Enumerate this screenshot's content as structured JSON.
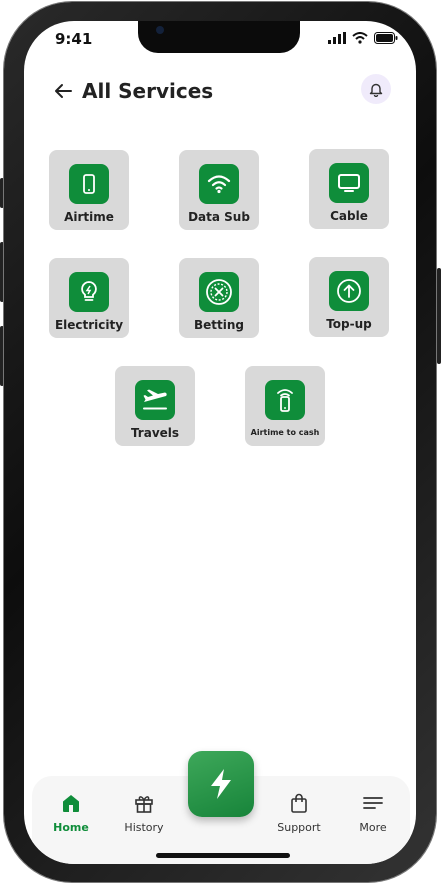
{
  "status_bar": {
    "time": "9:41"
  },
  "header": {
    "title": "All Services"
  },
  "services": [
    {
      "label": "Airtime",
      "icon": "phone-icon"
    },
    {
      "label": "Data Sub",
      "icon": "wifi-icon"
    },
    {
      "label": "Cable",
      "icon": "tv-icon"
    },
    {
      "label": "Electricity",
      "icon": "bulb-icon"
    },
    {
      "label": "Betting",
      "icon": "roulette-icon"
    },
    {
      "label": "Top-up",
      "icon": "arrow-up-circle-icon"
    },
    {
      "label": "Travels",
      "icon": "plane-icon"
    },
    {
      "label": "Airtime to cash",
      "icon": "phone-signal-icon"
    }
  ],
  "nav": [
    {
      "label": "Home",
      "icon": "home-icon",
      "active": true
    },
    {
      "label": "History",
      "icon": "gift-icon"
    },
    {
      "label": "Support",
      "icon": "bag-icon"
    },
    {
      "label": "More",
      "icon": "menu-icon"
    }
  ],
  "colors": {
    "accent": "#0f8d3a",
    "tile": "#d9d9d9",
    "bell_bg": "#f0ebfb"
  }
}
